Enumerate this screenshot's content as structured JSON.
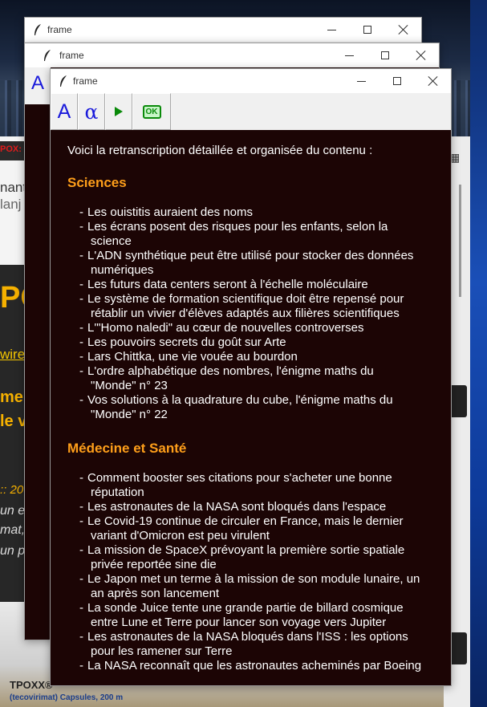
{
  "background": {
    "red_label": "POX:",
    "line1": "nant",
    "line2": "lanj",
    "big_text": "PO",
    "link_text": "wire",
    "heading1": "mer",
    "heading2": "le v",
    "date_text": ":: 20",
    "italic1": "un e",
    "italic2": "mat,",
    "italic3": "un p",
    "product_name": "TPOXX®",
    "product_sub": "(tecovirimat) Capsules, 200 m"
  },
  "windows": {
    "back1": {
      "title": "frame"
    },
    "back2": {
      "title": "frame",
      "toolbar_glyph": "A"
    },
    "front": {
      "title": "frame",
      "toolbar": {
        "font_button": "A",
        "alpha_button": "α",
        "run_button_icon": "play-icon",
        "ok_button": "OK"
      },
      "accent_color": "#ff9f1a",
      "background_color": "#1c0505"
    }
  },
  "content": {
    "intro": "Voici la retranscription détaillée et organisée du contenu :",
    "sections": [
      {
        "title": "Sciences",
        "items": [
          [
            "Les ouistitis auraient des noms"
          ],
          [
            "Les écrans posent des risques pour les enfants, selon la",
            "science"
          ],
          [
            "L'ADN synthétique peut être utilisé pour stocker des données",
            "numériques"
          ],
          [
            "Les futurs data centers seront à l'échelle moléculaire"
          ],
          [
            "Le système de formation scientifique doit être repensé pour",
            "rétablir un vivier d'élèves adaptés aux filières scientifiques"
          ],
          [
            "L'\"Homo naledi\" au cœur de nouvelles controverses"
          ],
          [
            "Les pouvoirs secrets du goût sur Arte"
          ],
          [
            "Lars Chittka, une vie vouée au bourdon"
          ],
          [
            "L'ordre alphabétique des nombres, l'énigme maths du",
            "\"Monde\" n° 23"
          ],
          [
            "Vos solutions à la quadrature du cube, l'énigme maths du",
            "\"Monde\" n° 22"
          ]
        ]
      },
      {
        "title": "Médecine et Santé",
        "items": [
          [
            "Comment booster ses citations pour s'acheter une bonne",
            "réputation"
          ],
          [
            "Les astronautes de la NASA sont bloqués dans l'espace"
          ],
          [
            "Le Covid-19 continue de circuler en France, mais le dernier",
            "variant d'Omicron est peu virulent"
          ],
          [
            "La mission de SpaceX prévoyant la première sortie spatiale",
            "privée reportée sine die"
          ],
          [
            "Le Japon met un terme à la mission de son module lunaire, un",
            "an après son lancement"
          ],
          [
            "La sonde Juice tente une grande partie de billard cosmique",
            "entre Lune et Terre pour lancer son voyage vers Jupiter"
          ],
          [
            "Les astronautes de la NASA bloqués dans l'ISS : les options",
            "pour les ramener sur Terre"
          ],
          [
            "La NASA reconnaît que les astronautes acheminés par Boeing"
          ]
        ]
      }
    ]
  }
}
